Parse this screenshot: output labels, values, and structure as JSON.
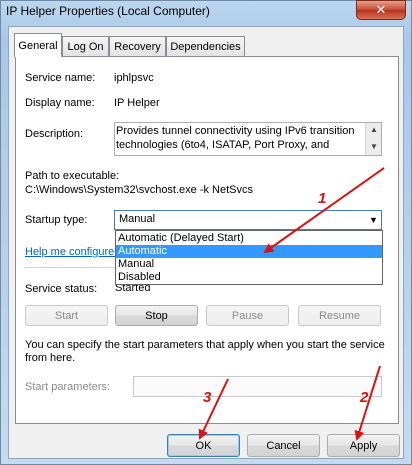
{
  "window": {
    "title": "IP Helper Properties (Local Computer)",
    "close_glyph": "✕"
  },
  "tabs": [
    {
      "label": "General",
      "active": true
    },
    {
      "label": "Log On",
      "active": false
    },
    {
      "label": "Recovery",
      "active": false
    },
    {
      "label": "Dependencies",
      "active": false
    }
  ],
  "general": {
    "service_name_label": "Service name:",
    "service_name_value": "iphlpsvc",
    "display_name_label": "Display name:",
    "display_name_value": "IP Helper",
    "description_label": "Description:",
    "description_value": "Provides tunnel connectivity using IPv6 transition technologies (6to4, ISATAP, Port Proxy, and",
    "path_label": "Path to executable:",
    "path_value": "C:\\Windows\\System32\\svchost.exe -k NetSvcs",
    "startup_type_label": "Startup type:",
    "startup_type_value": "Manual",
    "startup_options": [
      {
        "label": "Automatic (Delayed Start)",
        "selected": false
      },
      {
        "label": "Automatic",
        "selected": true
      },
      {
        "label": "Manual",
        "selected": false
      },
      {
        "label": "Disabled",
        "selected": false
      }
    ],
    "help_link": "Help me configure s",
    "service_status_label": "Service status:",
    "service_status_value": "Started",
    "buttons": {
      "start": "Start",
      "stop": "Stop",
      "pause": "Pause",
      "resume": "Resume"
    },
    "info_text_line1": "You can specify the start parameters that apply when you start the service",
    "info_text_line2": "from here.",
    "start_params_label": "Start parameters:",
    "start_params_value": ""
  },
  "footer": {
    "ok": "OK",
    "cancel": "Cancel",
    "apply": "Apply"
  },
  "annotations": {
    "color": "#dd1111",
    "labels": [
      "1",
      "2",
      "3"
    ]
  },
  "icons": {
    "scroll_up": "▲",
    "scroll_down": "▼",
    "combo_arrow": "▼"
  }
}
